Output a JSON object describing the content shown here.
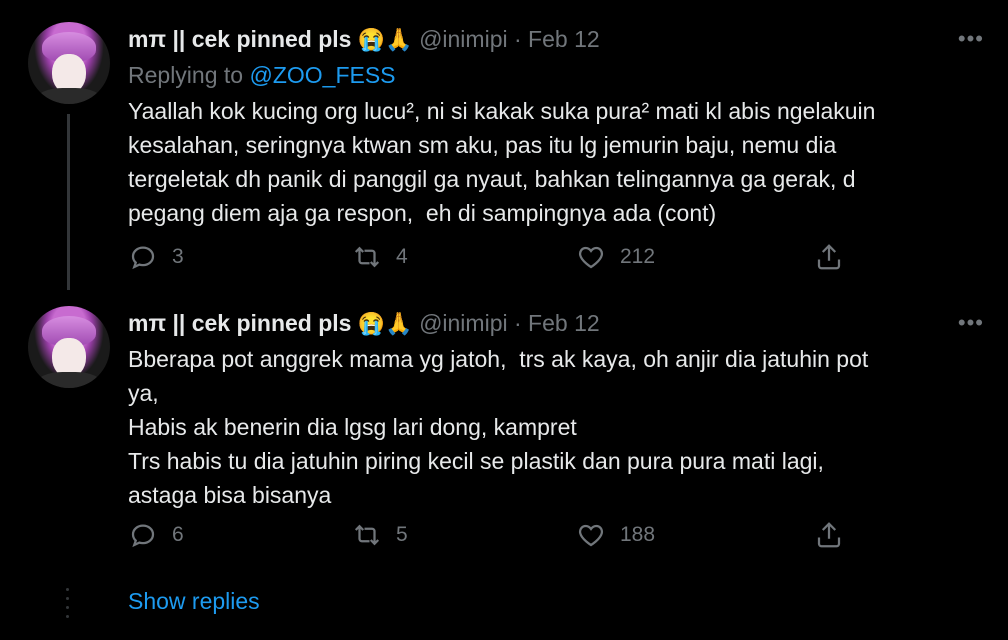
{
  "tweets": [
    {
      "name": "mπ || cek pinned pls",
      "emoji": "😭🙏",
      "handle": "@inimipi",
      "separator": "·",
      "date": "Feb 12",
      "more": "•••",
      "replying_prefix": "Replying to",
      "replying_to": "@ZOO_FESS",
      "text": "Yaallah kok kucing org lucu², ni si kakak suka pura² mati kl abis ngelakuin\nkesalahan, seringnya ktwan sm aku, pas itu lg jemurin baju, nemu dia\ntergeletak dh panik di panggil ga nyaut, bahkan telingannya ga gerak, d\npegang diem aja ga respon,  eh di sampingnya ada (cont)",
      "replies": "3",
      "retweets": "4",
      "likes": "212"
    },
    {
      "name": "mπ || cek pinned pls",
      "emoji": "😭🙏",
      "handle": "@inimipi",
      "separator": "·",
      "date": "Feb 12",
      "more": "•••",
      "text": "Bberapa pot anggrek mama yg jatoh,  trs ak kaya, oh anjir dia jatuhin pot\nya,\nHabis ak benerin dia lgsg lari dong, kampret\nTrs habis tu dia jatuhin piring kecil se plastik dan pura pura mati lagi,\nastaga bisa bisanya",
      "replies": "6",
      "retweets": "5",
      "likes": "188"
    }
  ],
  "show_replies": "Show replies",
  "colors": {
    "background": "#000000",
    "text": "#e7e9ea",
    "muted": "#71767b",
    "accent": "#1d9bf0"
  }
}
